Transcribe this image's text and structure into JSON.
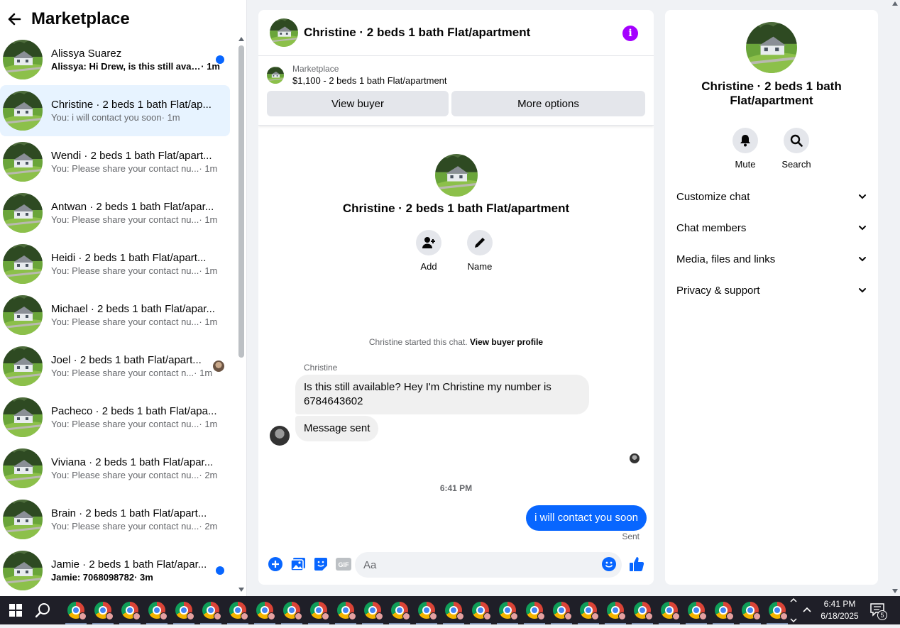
{
  "sidebar": {
    "title": "Marketplace",
    "conversations": [
      {
        "name": "Alissya Suarez",
        "preview": "Alissya: Hi Drew, is this still avai...",
        "time": " · 1m",
        "unread": true
      },
      {
        "name": "Christine · 2 beds 1 bath Flat/ap...",
        "preview": "You: i will contact you soon",
        "time": " · 1m",
        "active": true
      },
      {
        "name": "Wendi · 2 beds 1 bath Flat/apart...",
        "preview": "You: Please share your contact nu...",
        "time": " · 1m"
      },
      {
        "name": "Antwan · 2 beds 1 bath Flat/apar...",
        "preview": "You: Please share your contact nu...",
        "time": " · 1m"
      },
      {
        "name": "Heidi · 2 beds 1 bath Flat/apart...",
        "preview": "You: Please share your contact nu...",
        "time": " · 1m"
      },
      {
        "name": "Michael · 2 beds 1 bath Flat/apar...",
        "preview": "You: Please share your contact nu...",
        "time": " · 1m"
      },
      {
        "name": "Joel · 2 beds 1 bath Flat/apart...",
        "preview": "You: Please share your contact n...",
        "time": " · 1m",
        "seen": true
      },
      {
        "name": "Pacheco · 2 beds 1 bath Flat/apa...",
        "preview": "You: Please share your contact nu...",
        "time": " · 1m"
      },
      {
        "name": "Viviana · 2 beds 1 bath Flat/apar...",
        "preview": "You: Please share your contact nu...",
        "time": " · 2m"
      },
      {
        "name": "Brain · 2 beds 1 bath Flat/apart...",
        "preview": "You: Please share your contact nu...",
        "time": " · 2m"
      },
      {
        "name": "Jamie · 2 beds 1 bath Flat/apar...",
        "preview": "Jamie: 7068098782",
        "time": " · 3m",
        "unread": true
      }
    ]
  },
  "chat": {
    "title": "Christine · 2 beds 1 bath Flat/apartment",
    "listing": {
      "source": "Marketplace",
      "price_title": "$1,100 - 2 beds 1 bath Flat/apartment",
      "view_buyer": "View buyer",
      "more_options": "More options"
    },
    "intro": {
      "title": "Christine · 2 beds 1 bath Flat/apartment",
      "add_label": "Add",
      "name_label": "Name"
    },
    "started_text": "Christine started this chat.",
    "view_profile": "View buyer profile",
    "sender": "Christine",
    "messages": {
      "m1": "Is this still available? Hey I'm Christine my number is 6784643602",
      "m2": "Message sent",
      "m3": "i will contact you soon"
    },
    "timestamp": "6:41 PM",
    "sent_label": "Sent",
    "composer_placeholder": "Aa"
  },
  "info_panel": {
    "title": "Christine · 2 beds 1 bath Flat/apartment",
    "mute_label": "Mute",
    "search_label": "Search",
    "sections": [
      "Customize chat",
      "Chat members",
      "Media, files and links",
      "Privacy & support"
    ]
  },
  "taskbar": {
    "time": "6:41 PM",
    "date": "6/18/2025",
    "notification_count": "5"
  },
  "colors": {
    "accent": "#0866ff",
    "info": "#a400ff",
    "active_bg": "#e7f3ff"
  }
}
